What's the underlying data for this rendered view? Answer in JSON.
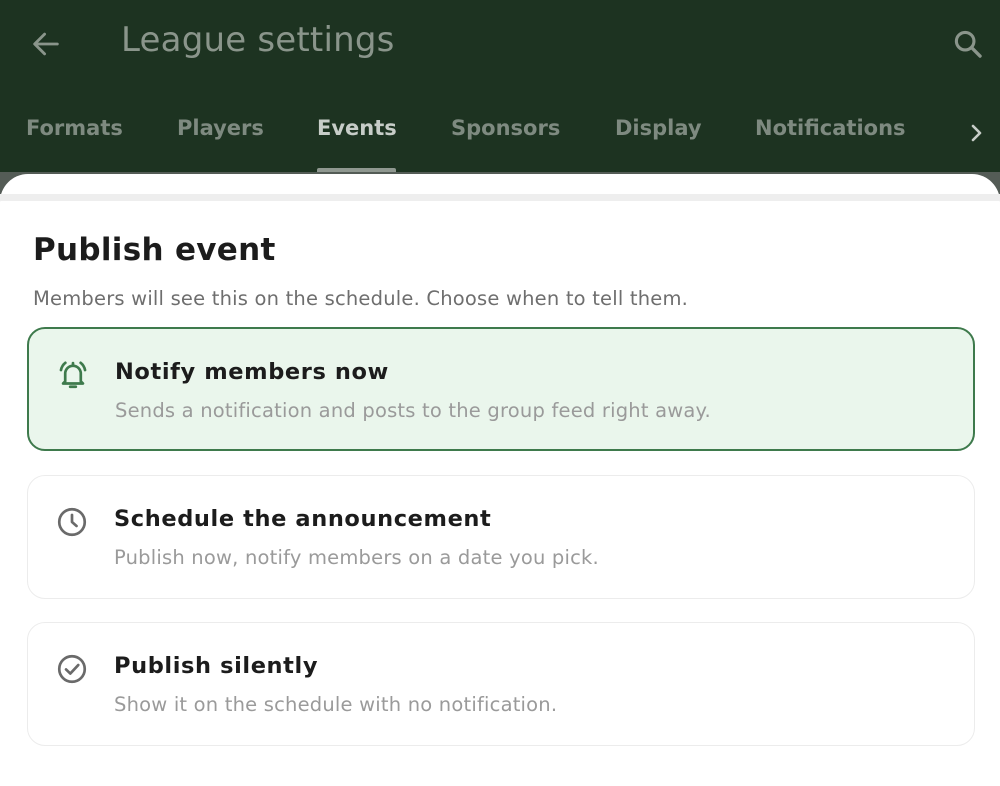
{
  "appbar": {
    "title": "League settings",
    "back_icon": "arrow-left-icon",
    "search_icon": "search-icon"
  },
  "tabs": {
    "items": [
      {
        "label": "Formats"
      },
      {
        "label": "Players"
      },
      {
        "label": "Events",
        "active": true
      },
      {
        "label": "Sponsors"
      },
      {
        "label": "Display"
      },
      {
        "label": "Notifications"
      }
    ],
    "next_icon": "chevron-right-icon"
  },
  "sheet": {
    "title": "Publish event",
    "subtitle": "Members will see this on the schedule. Choose when to tell them.",
    "options": [
      {
        "icon": "bell-ringing-icon",
        "title": "Notify members now",
        "description": "Sends a notification and posts to the group feed right away.",
        "selected": true
      },
      {
        "icon": "clock-icon",
        "title": "Schedule the announcement",
        "description": "Publish now, notify members on a date you pick.",
        "selected": false
      },
      {
        "icon": "check-circle-icon",
        "title": "Publish silently",
        "description": "Show it on the schedule with no notification.",
        "selected": false
      }
    ]
  },
  "colors": {
    "appbar_bg": "#1d3321",
    "accent": "#3e7a4c",
    "selected_bg": "#eaf6ec"
  }
}
